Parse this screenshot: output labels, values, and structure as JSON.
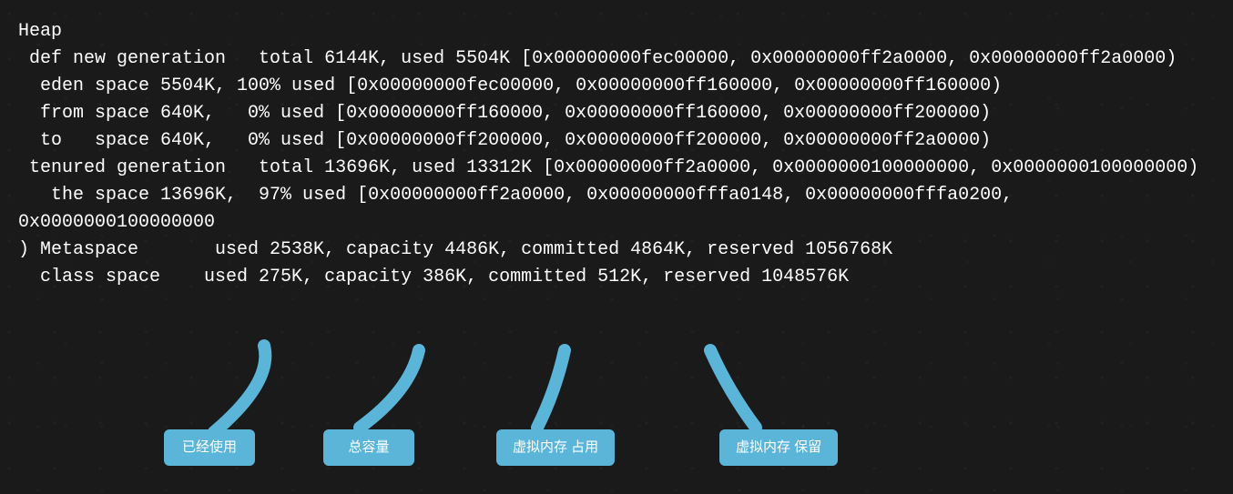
{
  "heap": {
    "line0": "Heap",
    "line1": " def new generation   total 6144K, used 5504K [0x00000000fec00000, 0x00000000ff2a0000, 0x00000000ff2a0000)",
    "line2": "  eden space 5504K, 100% used [0x00000000fec00000, 0x00000000ff160000, 0x00000000ff160000)",
    "line3": "  from space 640K,   0% used [0x00000000ff160000, 0x00000000ff160000, 0x00000000ff200000)",
    "line4": "  to   space 640K,   0% used [0x00000000ff200000, 0x00000000ff200000, 0x00000000ff2a0000)",
    "line5": " tenured generation   total 13696K, used 13312K [0x00000000ff2a0000, 0x0000000100000000, 0x0000000100000000)",
    "line6": "   the space 13696K,  97% used [0x00000000ff2a0000, 0x00000000fffa0148, 0x00000000fffa0200, 0x0000000100000000",
    "line7": ") Metaspace       used 2538K, capacity 4486K, committed 4864K, reserved 1056768K",
    "line8": "  class space    used 275K, capacity 386K, committed 512K, reserved 1048576K"
  },
  "callouts": {
    "used": "已经使用",
    "capacity": "总容量",
    "committed": "虚拟内存\n占用",
    "reserved": "虚拟内存\n保留"
  }
}
